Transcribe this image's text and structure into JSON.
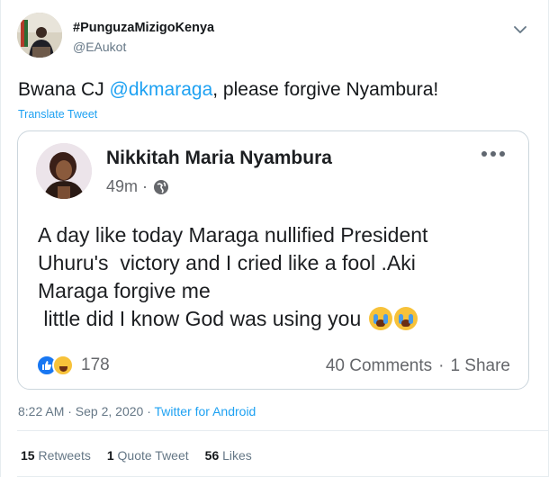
{
  "tweet": {
    "display_name": "#PunguzaMizigoKenya",
    "handle": "@EAukot",
    "text_before": "Bwana CJ ",
    "mention": "@dkmaraga",
    "text_after": ", please forgive Nyambura!",
    "translate_label": "Translate Tweet",
    "timestamp": "8:22 AM · Sep 2, 2020 · ",
    "client": "Twitter for Android"
  },
  "embedded_post": {
    "author": "Nikkitah Maria Nyambura",
    "time": "49m ·",
    "body_lines": [
      "A day like today Maraga nullified President",
      "Uhuru's  victory and I cried like a fool .Aki",
      "Maraga forgive me",
      " little did I know God was using you"
    ],
    "reaction_count": "178",
    "comments": "40 Comments",
    "shares": "1 Share"
  },
  "engagement": {
    "retweets_count": "15",
    "retweets_label": "Retweets",
    "quotes_count": "1",
    "quotes_label": "Quote Tweet",
    "likes_count": "56",
    "likes_label": "Likes"
  },
  "colors": {
    "link": "#1da1f2",
    "secondary_text": "#657786",
    "border": "#ccd6dd"
  }
}
